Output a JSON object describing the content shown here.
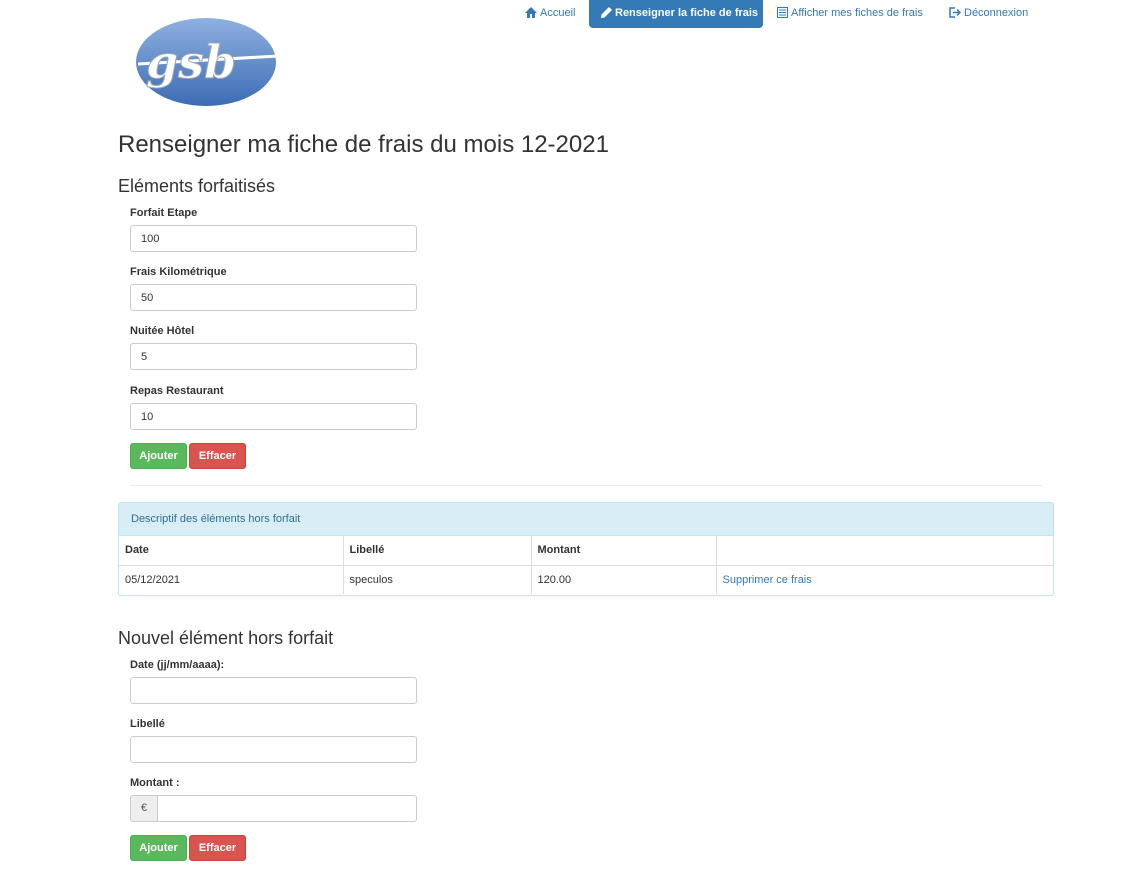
{
  "logo": {
    "text": "gsb"
  },
  "nav": {
    "accueil": "Accueil",
    "renseigner": "Renseigner la fiche de frais",
    "afficher": "Afficher mes fiches de frais",
    "deconnexion": "Déconnexion"
  },
  "page_title": "Renseigner ma fiche de frais du mois 12-2021",
  "forfait": {
    "title": "Eléments forfaitisés",
    "fields": [
      {
        "label": "Forfait Etape",
        "value": "100"
      },
      {
        "label": "Frais Kilométrique",
        "value": "50"
      },
      {
        "label": "Nuitée Hôtel",
        "value": "5"
      },
      {
        "label": "Repas Restaurant",
        "value": "10"
      }
    ],
    "add_label": "Ajouter",
    "clear_label": "Effacer"
  },
  "hors_forfait_table": {
    "heading": "Descriptif des éléments hors forfait",
    "columns": [
      "Date",
      "Libellé",
      "Montant",
      ""
    ],
    "rows": [
      {
        "date": "05/12/2021",
        "libelle": "speculos",
        "montant": "120.00",
        "action": "Supprimer ce frais"
      }
    ]
  },
  "nouvel": {
    "title": "Nouvel élément hors forfait",
    "date_label": "Date (jj/mm/aaaa):",
    "date_value": "",
    "libelle_label": "Libellé",
    "libelle_value": "",
    "montant_label": "Montant :",
    "montant_value": "",
    "currency": "€",
    "add_label": "Ajouter",
    "clear_label": "Effacer"
  },
  "colors": {
    "primary": "#337ab7",
    "success": "#5cb85c",
    "danger": "#d9534f",
    "info_bg": "#d9edf7"
  }
}
